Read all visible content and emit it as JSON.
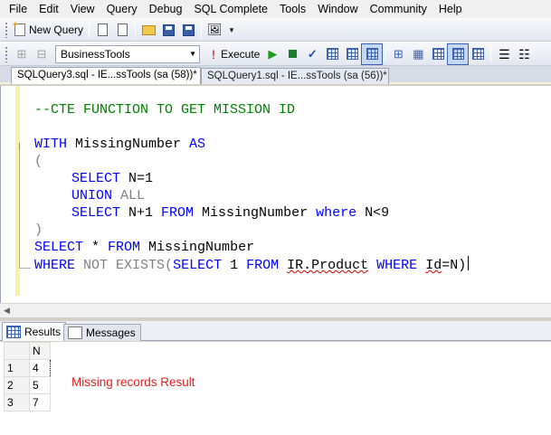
{
  "menu": [
    "File",
    "Edit",
    "View",
    "Query",
    "Debug",
    "SQL Complete",
    "Tools",
    "Window",
    "Community",
    "Help"
  ],
  "toolbar1": {
    "new_query_label": "New Query"
  },
  "toolbar2": {
    "database": "BusinessTools",
    "execute_label": "Execute"
  },
  "tabs": [
    {
      "label": "SQLQuery3.sql - IE...ssTools (sa (58))*",
      "active": true
    },
    {
      "label": "SQLQuery1.sql - IE...ssTools (sa (56))*",
      "active": false
    }
  ],
  "editor": {
    "comment": "--CTE FUNCTION TO GET MISSION ID",
    "line_with": [
      "WITH",
      " MissingNumber ",
      "AS"
    ],
    "open_paren": "(",
    "line_select1": [
      "SELECT",
      " N=1"
    ],
    "line_union": [
      "UNION",
      " ",
      "ALL"
    ],
    "line_select2": [
      "SELECT",
      " N+1 ",
      "FROM",
      " MissingNumber ",
      "where",
      " N<9"
    ],
    "close_paren": ")",
    "line_select3": [
      "SELECT",
      " * ",
      "FROM",
      " MissingNumber"
    ],
    "line_where": [
      "WHERE",
      " NOT EXISTS",
      "(",
      "SELECT",
      " 1 ",
      "FROM",
      " ",
      "IR.Product",
      " ",
      "WHERE",
      " ",
      "Id",
      "=N)"
    ]
  },
  "results_tabs": [
    "Results",
    "Messages"
  ],
  "grid": {
    "header": "N",
    "rows": [
      {
        "num": "1",
        "value": "4"
      },
      {
        "num": "2",
        "value": "5"
      },
      {
        "num": "3",
        "value": "7"
      }
    ]
  },
  "annotation": "Missing records Result",
  "colors": {
    "keyword": "#0000ff",
    "comment": "#008000",
    "gray_keyword": "#808080",
    "annotation": "#e02020"
  }
}
